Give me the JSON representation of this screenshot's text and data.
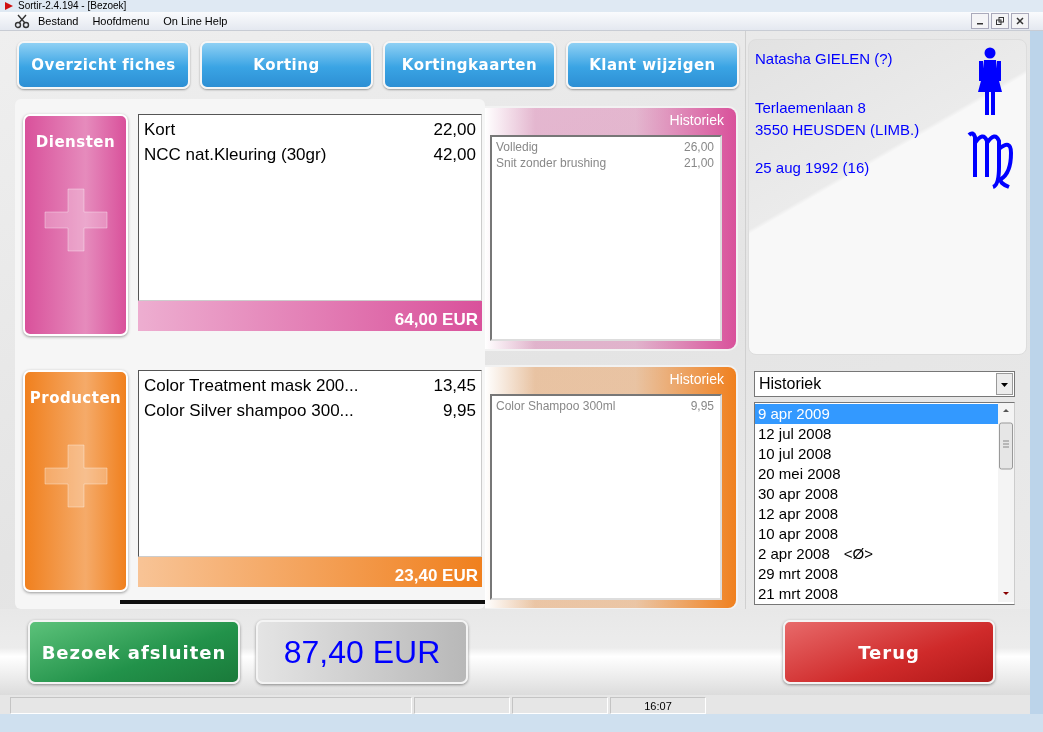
{
  "window": {
    "title": "Sortir-2.4.194 - [Bezoek]"
  },
  "menu": [
    "Bestand",
    "Hoofdmenu",
    "On Line Help"
  ],
  "toolbar_buttons": [
    "Overzicht fiches",
    "Korting",
    "Kortingkaarten",
    "Klant wijzigen"
  ],
  "sections": [
    {
      "kind": "services",
      "label": "Diensten",
      "color": "#d9519b",
      "items": [
        {
          "name": "Kort",
          "price": "22,00"
        },
        {
          "name": "NCC nat.Kleuring (30gr)",
          "price": "42,00"
        }
      ],
      "total": "64,00 EUR",
      "history": {
        "title": "Historiek",
        "items": [
          {
            "name": "Volledig",
            "price": "26,00"
          },
          {
            "name": "Snit zonder brushing",
            "price": "21,00"
          }
        ]
      }
    },
    {
      "kind": "products",
      "label": "Producten",
      "color": "#f0801e",
      "items": [
        {
          "name": "Color Treatment mask 200...",
          "price": "13,45"
        },
        {
          "name": "Color Silver shampoo 300...",
          "price": "9,95"
        }
      ],
      "total": "23,40 EUR",
      "history": {
        "title": "Historiek",
        "items": [
          {
            "name": "Color Shampoo 300ml",
            "price": "9,95"
          }
        ]
      }
    }
  ],
  "customer": {
    "name": "Natasha GIELEN (?)",
    "street": "Terlaemenlaan 8",
    "city": "3550 HEUSDEN (LIMB.)",
    "birth": "25 aug 1992 (16)"
  },
  "history_select": {
    "value": "Historiek"
  },
  "visits": [
    {
      "date": "9 apr 2009",
      "selected": true
    },
    {
      "date": "12 jul 2008",
      "selected": false
    },
    {
      "date": "10 jul 2008",
      "selected": false
    },
    {
      "date": "20 mei 2008",
      "selected": false
    },
    {
      "date": "30 apr 2008",
      "selected": false
    },
    {
      "date": "12 apr 2008",
      "selected": false
    },
    {
      "date": "10 apr 2008",
      "selected": false
    },
    {
      "date": "2 apr 2008",
      "note": "<Ø>",
      "selected": false
    },
    {
      "date": "29 mrt 2008",
      "selected": false
    },
    {
      "date": "21 mrt 2008",
      "selected": false
    }
  ],
  "close_button": "Bezoek afsluiten",
  "grand_total": "87,40 EUR",
  "back_button": "Terug",
  "status_bar": {
    "time": "16:07"
  }
}
